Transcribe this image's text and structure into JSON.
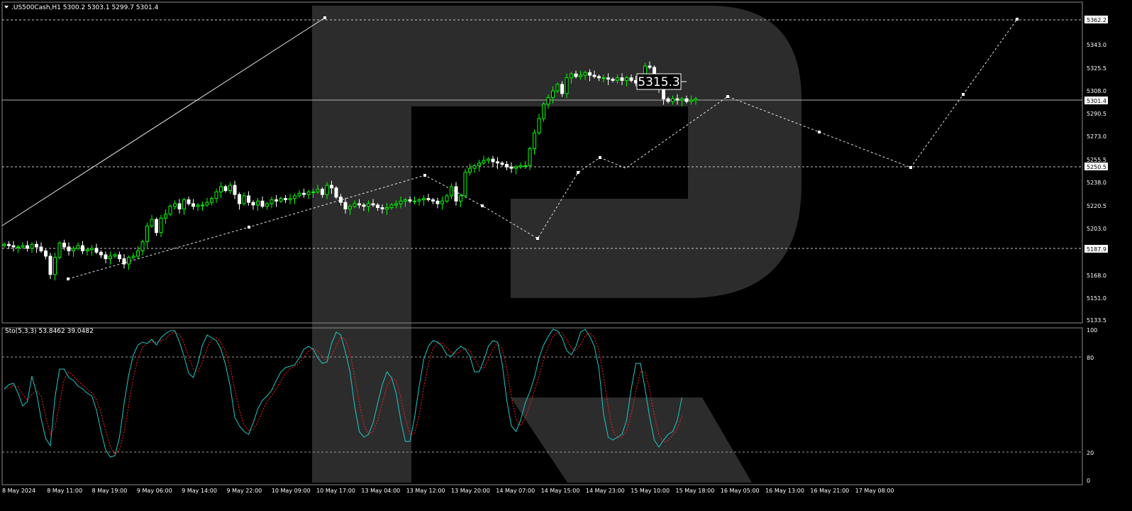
{
  "main_panel": {
    "title": ".US500Cash,H1  5300.2 5303.1 5299.7 5301.4",
    "price_callout": "5315.3",
    "y_ticks": [
      "5343.0",
      "5325.5",
      "5308.0",
      "5290.5",
      "5273.0",
      "5255.5",
      "5238.0",
      "5220.5",
      "5203.0",
      "5168.0",
      "5151.0",
      "5133.5"
    ],
    "price_tags": [
      "5362.2",
      "5301.4",
      "5250.5",
      "5187.9"
    ],
    "current_price": 5301.4
  },
  "sub_panel": {
    "title": "Sto(5,3,3) 53.8462 39.0482",
    "y_ticks": [
      "100",
      "80",
      "20",
      "0"
    ],
    "levels": [
      80,
      20
    ]
  },
  "x_axis": {
    "labels": [
      "8 May 2024",
      "8 May 11:00",
      "8 May 19:00",
      "9 May 06:00",
      "9 May 14:00",
      "9 May 22:00",
      "10 May 09:00",
      "10 May 17:00",
      "13 May 04:00",
      "13 May 12:00",
      "13 May 20:00",
      "14 May 07:00",
      "14 May 15:00",
      "14 May 23:00",
      "15 May 10:00",
      "15 May 18:00",
      "16 May 05:00",
      "16 May 13:00",
      "16 May 21:00",
      "17 May 08:00"
    ]
  },
  "chart_data": {
    "type": "candlestick",
    "symbol": ".US500Cash",
    "timeframe": "H1",
    "ohlc_last": {
      "open": 5300.2,
      "high": 5303.1,
      "low": 5299.7,
      "close": 5301.4
    },
    "ylim": [
      5133.5,
      5371
    ],
    "candle_colors": {
      "up": "#00ff00",
      "down": "#ffffff"
    },
    "closes": [
      5191,
      5190,
      5189,
      5189,
      5190,
      5188,
      5191,
      5189,
      5186,
      5182,
      5168,
      5181,
      5192,
      5189,
      5186,
      5188,
      5190,
      5186,
      5187,
      5188,
      5185,
      5183,
      5180,
      5182,
      5183,
      5180,
      5176,
      5181,
      5182,
      5186,
      5193,
      5205,
      5210,
      5200,
      5211,
      5214,
      5220,
      5222,
      5218,
      5225,
      5222,
      5220,
      5221,
      5221,
      5223,
      5226,
      5231,
      5235,
      5232,
      5236,
      5229,
      5222,
      5228,
      5223,
      5221,
      5224,
      5220,
      5222,
      5225,
      5224,
      5226,
      5225,
      5226,
      5228,
      5230,
      5229,
      5231,
      5231,
      5233,
      5229,
      5236,
      5234,
      5227,
      5223,
      5218,
      5220,
      5222,
      5221,
      5220,
      5222,
      5221,
      5219,
      5218,
      5219,
      5221,
      5222,
      5224,
      5225,
      5224,
      5224,
      5225,
      5226,
      5225,
      5224,
      5222,
      5224,
      5228,
      5235,
      5224,
      5228,
      5246,
      5249,
      5251,
      5253,
      5255,
      5256,
      5254,
      5253,
      5252,
      5250,
      5249,
      5250,
      5251,
      5251,
      5264,
      5276,
      5287,
      5298,
      5303,
      5308,
      5313,
      5306,
      5318,
      5321,
      5319,
      5320,
      5322,
      5320,
      5319,
      5318,
      5318,
      5317,
      5316,
      5318,
      5316,
      5318,
      5316,
      5314,
      5318,
      5327,
      5326,
      5315,
      5310,
      5302,
      5300,
      5302,
      5301,
      5302,
      5300,
      5301,
      5302
    ],
    "sto_k": [
      58,
      61,
      62,
      55,
      46,
      49,
      67,
      55,
      37,
      23,
      18,
      52,
      72,
      72,
      66,
      64,
      60,
      58,
      55,
      53,
      43,
      28,
      15,
      10,
      11,
      24,
      48,
      68,
      82,
      89,
      91,
      90,
      93,
      89,
      94,
      97,
      99,
      99,
      91,
      81,
      69,
      66,
      76,
      89,
      96,
      94,
      92,
      86,
      75,
      60,
      38,
      32,
      28,
      26,
      34,
      44,
      50,
      53,
      57,
      64,
      70,
      73,
      74,
      75,
      80,
      86,
      88,
      86,
      80,
      76,
      77,
      90,
      98,
      96,
      84,
      70,
      46,
      28,
      24,
      26,
      34,
      48,
      61,
      70,
      66,
      55,
      36,
      21,
      21,
      38,
      60,
      79,
      88,
      92,
      91,
      88,
      82,
      81,
      85,
      88,
      86,
      81,
      70,
      70,
      78,
      88,
      92,
      91,
      76,
      50,
      32,
      28,
      36,
      48,
      56,
      66,
      80,
      89,
      95,
      100,
      99,
      94,
      85,
      82,
      88,
      98,
      100,
      95,
      88,
      72,
      40,
      24,
      22,
      24,
      26,
      36,
      58,
      76,
      76,
      58,
      38,
      22,
      17,
      22,
      26,
      28,
      36,
      52
    ]
  }
}
